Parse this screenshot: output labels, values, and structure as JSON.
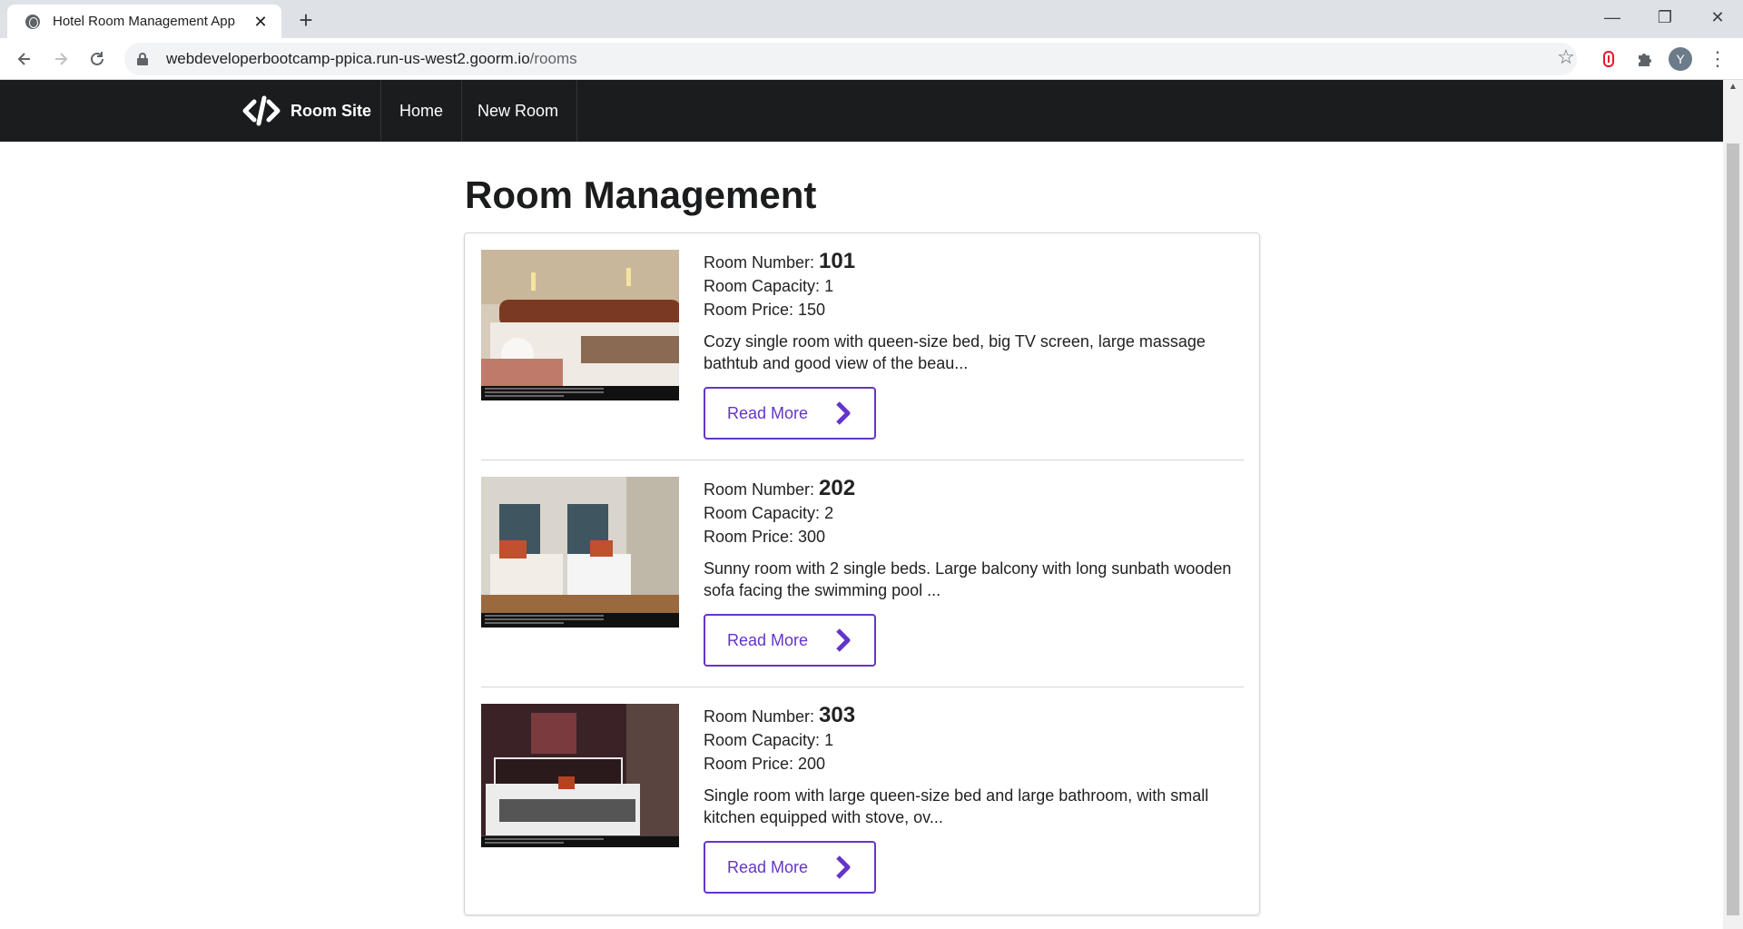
{
  "browser": {
    "tab_title": "Hotel Room Management App",
    "tab_close": "✕",
    "new_tab": "+",
    "url_host": "webdeveloperbootcamp-ppica.run-us-west2.goorm.io",
    "url_path": "/rooms",
    "avatar_letter": "Y",
    "window_controls": {
      "minimize": "—",
      "restore": "❐",
      "close": "✕"
    }
  },
  "navbar": {
    "brand": "Room Site",
    "items": [
      "Home",
      "New Room"
    ]
  },
  "page": {
    "title": "Room Management"
  },
  "labels": {
    "room_number": "Room Number: ",
    "room_capacity": "Room Capacity: ",
    "room_price": "Room Price: ",
    "read_more": "Read More"
  },
  "rooms": [
    {
      "number": "101",
      "capacity": "1",
      "price": "150",
      "description": "Cozy single room with queen-size bed, big TV screen, large massage bathtub and good view of the beau...",
      "image_colors": [
        "#b68a5a",
        "#e8e2da",
        "#7a4a2a"
      ]
    },
    {
      "number": "202",
      "capacity": "2",
      "price": "300",
      "description": "Sunny room with 2 single beds. Large balcony with long sunbath wooden sofa facing the swimming pool ...",
      "image_colors": [
        "#c8c2b6",
        "#3f5660",
        "#c0502e"
      ]
    },
    {
      "number": "303",
      "capacity": "1",
      "price": "200",
      "description": "Single room with large queen-size bed and large bathroom, with small kitchen equipped with stove, ov...",
      "image_colors": [
        "#3a2226",
        "#e6e6e6",
        "#9c3a22"
      ]
    }
  ],
  "colors": {
    "navbar_bg": "#1b1c1d",
    "accent": "#6435c9"
  }
}
